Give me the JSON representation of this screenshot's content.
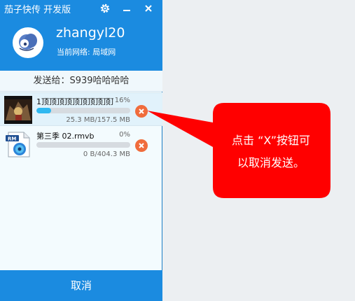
{
  "app": {
    "title": "茄子快传 开发版",
    "user": {
      "name": "zhangyl20",
      "network": "当前网络: 局域网"
    },
    "send_to": "发送给：S939哈哈哈哈",
    "files": [
      {
        "name": "1顶顶顶顶顶顶顶顶顶顶",
        "percent": "16%",
        "progress": 0.16,
        "size": "25.3 MB/157.5 MB"
      },
      {
        "name": "第三季 02.rmvb",
        "percent": "0%",
        "progress": 0,
        "size": "0 B/404.3 MB"
      }
    ],
    "footer_cancel": "取消"
  },
  "annotation": {
    "line1": "点击 “X”按钮可",
    "line2": "以取消发送。"
  },
  "colors": {
    "brand_blue": "#1b8be0",
    "progress": "#2fb8f0",
    "cancel_icon": "#f06c3c",
    "callout_red": "#ff0000"
  },
  "icons": [
    "gear-icon",
    "minimize-icon",
    "close-icon",
    "user-avatar-icon",
    "video-thumbnail",
    "rmvb-file-icon",
    "cancel-x-icon"
  ]
}
